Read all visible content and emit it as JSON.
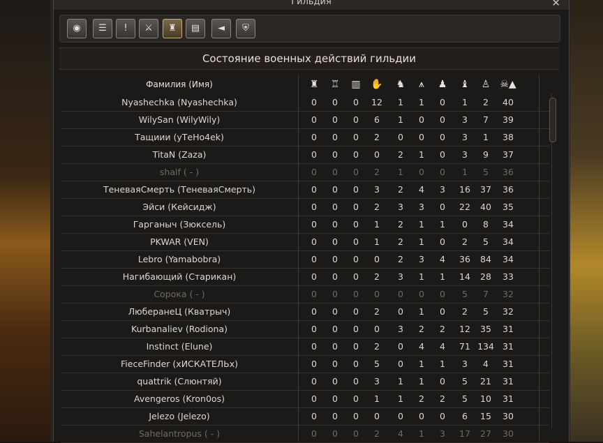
{
  "window": {
    "title": "Гильдия",
    "close_label": "✕"
  },
  "toolbar": {
    "buttons": [
      {
        "icon": "guild-crest-icon",
        "glyph": "◉"
      },
      {
        "icon": "member-list-icon",
        "glyph": "☰"
      },
      {
        "icon": "alert-icon",
        "glyph": "!"
      },
      {
        "icon": "shield-sword-icon",
        "glyph": "⚔"
      },
      {
        "icon": "war-status-icon",
        "glyph": "♜"
      },
      {
        "icon": "document-icon",
        "glyph": "▤"
      },
      {
        "icon": "horn-icon",
        "glyph": "◄"
      },
      {
        "icon": "defense-icon",
        "glyph": "⛨"
      }
    ]
  },
  "panel": {
    "heading": "Состояние военных действий гильдии"
  },
  "table": {
    "name_header": "Фамилия (Имя)",
    "column_icons": [
      {
        "icon": "fort-icon",
        "glyph": "♜"
      },
      {
        "icon": "tower-icon",
        "glyph": "♖"
      },
      {
        "icon": "gate-icon",
        "glyph": "▥"
      },
      {
        "icon": "hand-icon",
        "glyph": "✋"
      },
      {
        "icon": "wolf-icon",
        "glyph": "♞"
      },
      {
        "icon": "spikes-icon",
        "glyph": "⩚"
      },
      {
        "icon": "pawn-icon",
        "glyph": "♟"
      },
      {
        "icon": "dragon-icon",
        "glyph": "♝"
      },
      {
        "icon": "soldier-icon",
        "glyph": "♙"
      },
      {
        "icon": "skull-sort-icon",
        "glyph": "☠▲"
      }
    ],
    "rows": [
      {
        "name": "Nyashechka (Nyashechka)",
        "vals": [
          "0",
          "0",
          "0",
          "12",
          "1",
          "1",
          "0",
          "1",
          "2",
          "40"
        ],
        "dim": false
      },
      {
        "name": "WilySan (WilyWily)",
        "vals": [
          "0",
          "0",
          "0",
          "6",
          "1",
          "0",
          "0",
          "3",
          "7",
          "39"
        ],
        "dim": false
      },
      {
        "name": "Тащиии (уТеНо4ek)",
        "vals": [
          "0",
          "0",
          "0",
          "2",
          "0",
          "0",
          "0",
          "3",
          "1",
          "38"
        ],
        "dim": false
      },
      {
        "name": "TitaN (Zaza)",
        "vals": [
          "0",
          "0",
          "0",
          "0",
          "2",
          "1",
          "0",
          "3",
          "9",
          "37"
        ],
        "dim": false
      },
      {
        "name": "shalf ( - )",
        "vals": [
          "0",
          "0",
          "0",
          "2",
          "1",
          "0",
          "0",
          "1",
          "5",
          "36"
        ],
        "dim": true
      },
      {
        "name": "ТеневаяСмерть (ТеневаяСмерть)",
        "vals": [
          "0",
          "0",
          "0",
          "3",
          "2",
          "4",
          "3",
          "16",
          "37",
          "36"
        ],
        "dim": false
      },
      {
        "name": "Эйси (Кейсидж)",
        "vals": [
          "0",
          "0",
          "0",
          "2",
          "3",
          "3",
          "0",
          "22",
          "40",
          "35"
        ],
        "dim": false
      },
      {
        "name": "Гарганыч (Зюксель)",
        "vals": [
          "0",
          "0",
          "0",
          "1",
          "2",
          "1",
          "1",
          "0",
          "8",
          "34"
        ],
        "dim": false
      },
      {
        "name": "PKWAR (VEN)",
        "vals": [
          "0",
          "0",
          "0",
          "1",
          "2",
          "1",
          "0",
          "2",
          "5",
          "34"
        ],
        "dim": false
      },
      {
        "name": "Lebro (Yamabobra)",
        "vals": [
          "0",
          "0",
          "0",
          "0",
          "2",
          "3",
          "4",
          "36",
          "84",
          "34"
        ],
        "dim": false
      },
      {
        "name": "Нагибающий (Старикан)",
        "vals": [
          "0",
          "0",
          "0",
          "2",
          "3",
          "1",
          "1",
          "14",
          "28",
          "33"
        ],
        "dim": false
      },
      {
        "name": "Сорока ( - )",
        "vals": [
          "0",
          "0",
          "0",
          "0",
          "0",
          "0",
          "0",
          "5",
          "7",
          "32"
        ],
        "dim": true
      },
      {
        "name": "ЛюберанеЦ (Кватрыч)",
        "vals": [
          "0",
          "0",
          "0",
          "2",
          "0",
          "1",
          "0",
          "2",
          "5",
          "32"
        ],
        "dim": false
      },
      {
        "name": "Kurbanaliev (Rodiona)",
        "vals": [
          "0",
          "0",
          "0",
          "0",
          "3",
          "2",
          "2",
          "12",
          "35",
          "31"
        ],
        "dim": false
      },
      {
        "name": "Instinct (Elune)",
        "vals": [
          "0",
          "0",
          "0",
          "2",
          "0",
          "4",
          "4",
          "71",
          "134",
          "31"
        ],
        "dim": false
      },
      {
        "name": "FieceFinder (хИСКАТЕЛЬх)",
        "vals": [
          "0",
          "0",
          "0",
          "5",
          "0",
          "1",
          "1",
          "3",
          "4",
          "31"
        ],
        "dim": false
      },
      {
        "name": "quattrik (Слюнтяй)",
        "vals": [
          "0",
          "0",
          "0",
          "3",
          "1",
          "1",
          "0",
          "5",
          "21",
          "31"
        ],
        "dim": false
      },
      {
        "name": "Avengeros (Kron0os)",
        "vals": [
          "0",
          "0",
          "0",
          "1",
          "1",
          "2",
          "2",
          "5",
          "10",
          "31"
        ],
        "dim": false
      },
      {
        "name": "Jelezo (Jelezo)",
        "vals": [
          "0",
          "0",
          "0",
          "0",
          "0",
          "0",
          "0",
          "6",
          "15",
          "30"
        ],
        "dim": false
      },
      {
        "name": "Sahelantropus ( - )",
        "vals": [
          "0",
          "0",
          "0",
          "2",
          "4",
          "1",
          "3",
          "17",
          "27",
          "30"
        ],
        "dim": true
      }
    ]
  }
}
